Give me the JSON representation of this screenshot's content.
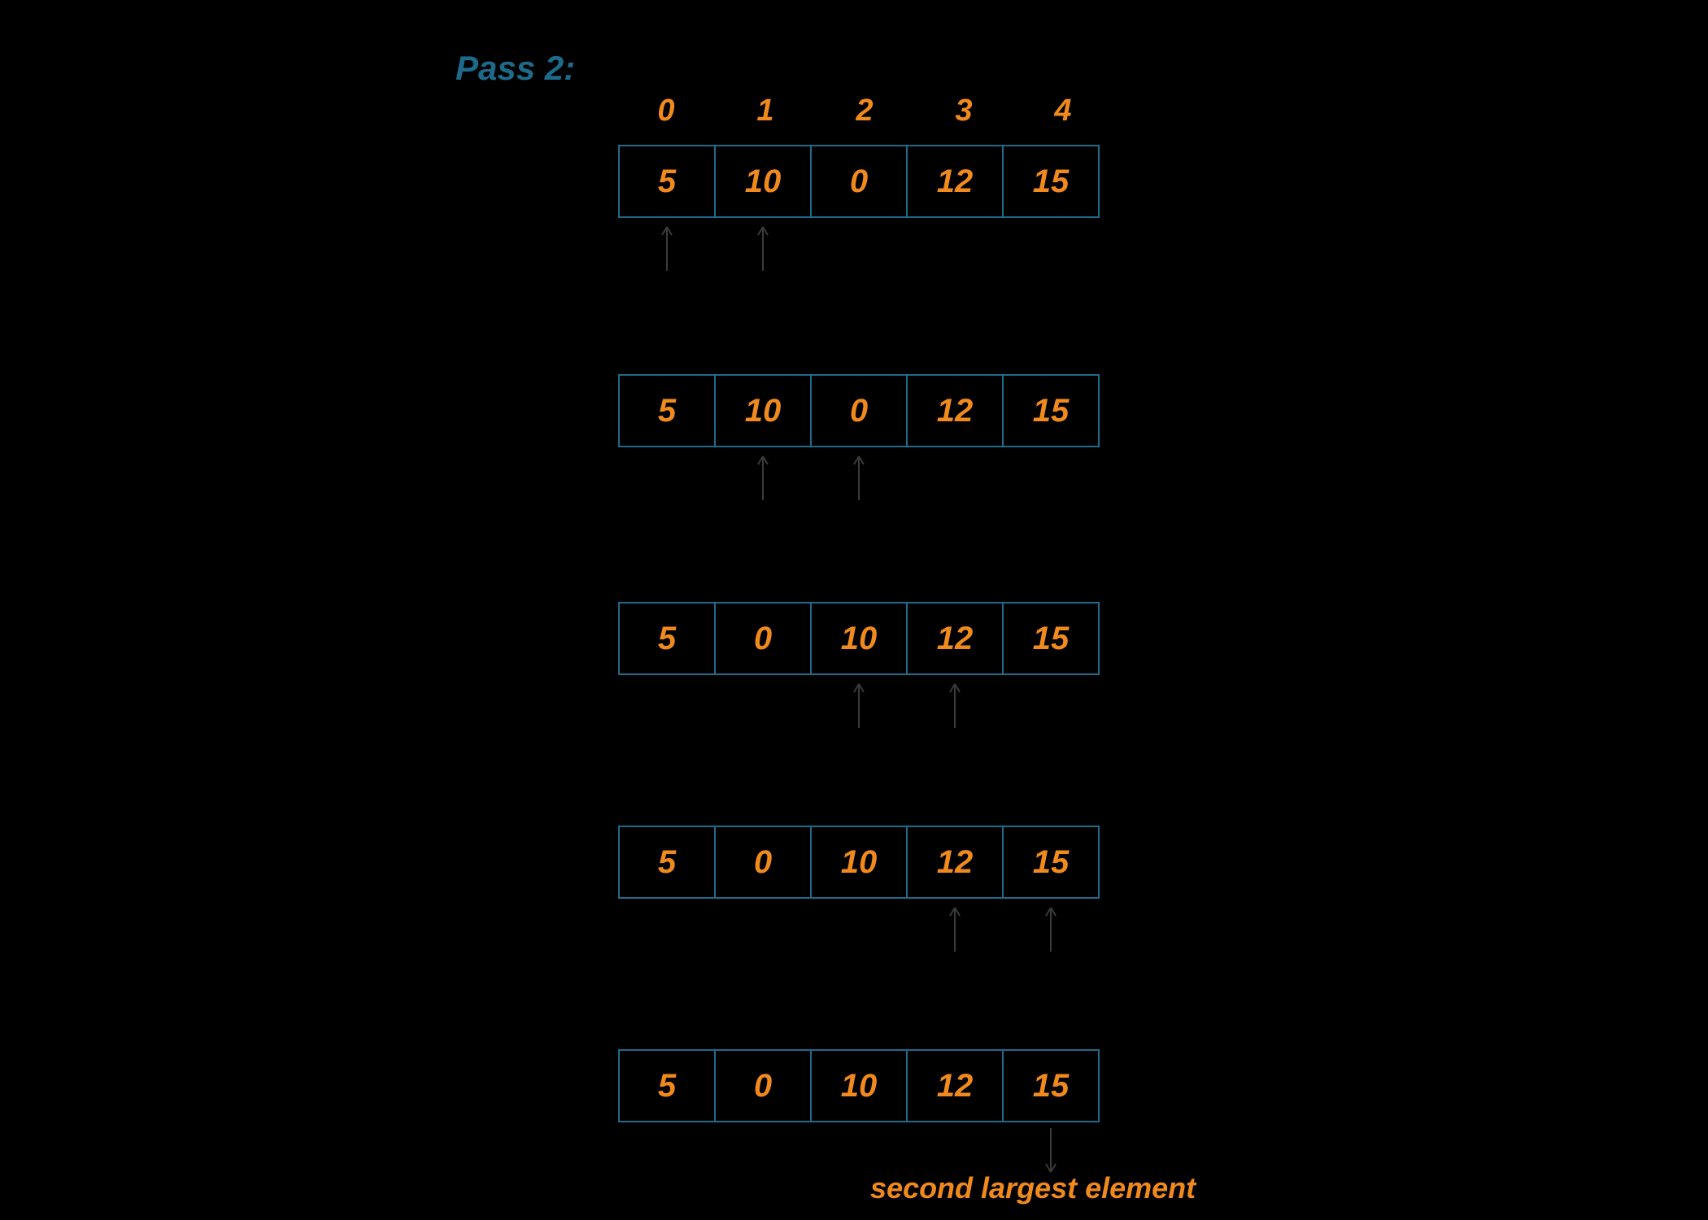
{
  "title": "Pass 2:",
  "indices": [
    "0",
    "1",
    "2",
    "3",
    "4"
  ],
  "rows": [
    {
      "values": [
        "5",
        "10",
        "0",
        "12",
        "15"
      ],
      "arrows_up_at": [
        0,
        1
      ]
    },
    {
      "values": [
        "5",
        "10",
        "0",
        "12",
        "15"
      ],
      "arrows_up_at": [
        1,
        2
      ]
    },
    {
      "values": [
        "5",
        "0",
        "10",
        "12",
        "15"
      ],
      "arrows_up_at": [
        2,
        3
      ]
    },
    {
      "values": [
        "5",
        "0",
        "10",
        "12",
        "15"
      ],
      "arrows_up_at": [
        3,
        4
      ]
    },
    {
      "values": [
        "5",
        "0",
        "10",
        "12",
        "15"
      ],
      "arrows_up_at": []
    }
  ],
  "final_arrow_down_at": 4,
  "annotation": "second largest element",
  "colors": {
    "cell_border": "#1e6a8a",
    "text_accent": "#f08a1c",
    "label": "#1e6a8a",
    "arrow": "#3a3a3a"
  }
}
